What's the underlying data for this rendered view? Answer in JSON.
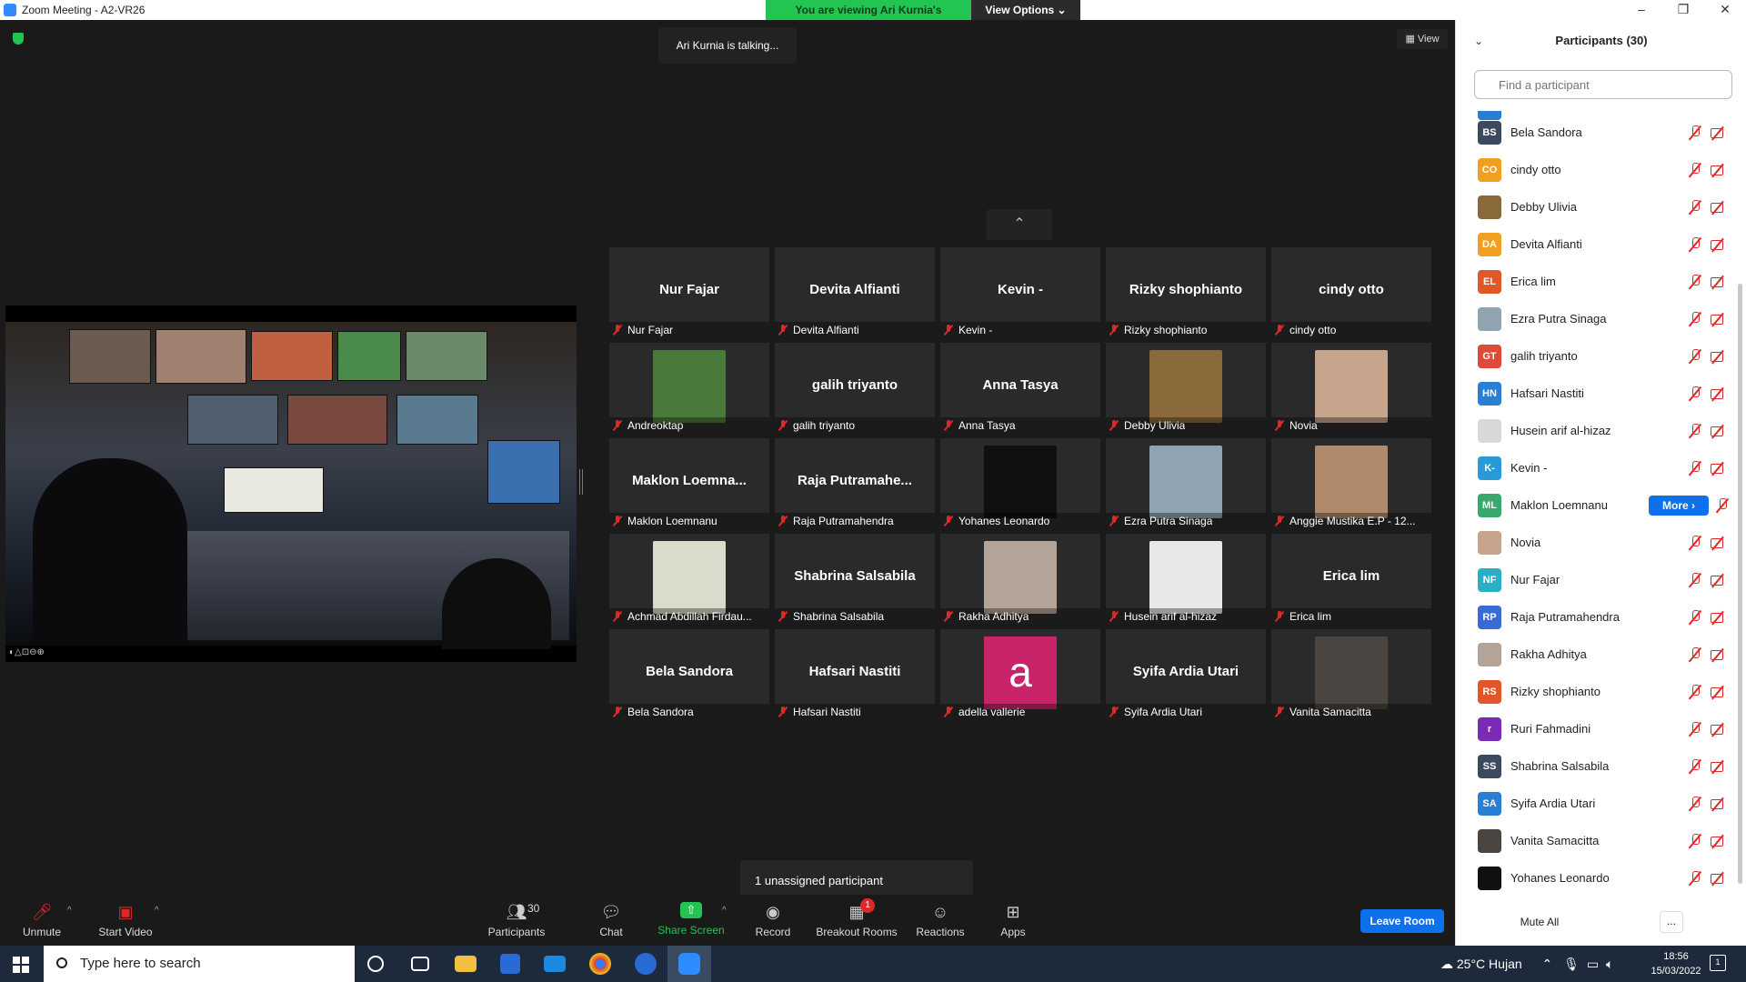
{
  "window": {
    "title": "Zoom Meeting - A2-VR26"
  },
  "banner": {
    "viewing": "You are viewing Ari Kurnia's screen",
    "view_options": "View Options ⌄"
  },
  "talking": "Ari Kurnia is talking...",
  "view_button": "View",
  "grid": [
    {
      "big": "Nur Fajar",
      "name": "Nur Fajar"
    },
    {
      "big": "Devita Alfianti",
      "name": "Devita Alfianti"
    },
    {
      "big": "Kevin -",
      "name": "Kevin -"
    },
    {
      "big": "Rizky shophianto",
      "name": "Rizky shophianto"
    },
    {
      "big": "cindy otto",
      "name": "cindy otto"
    },
    {
      "img": "#4a7a3a",
      "name": "Andreoktap"
    },
    {
      "big": "galih triyanto",
      "name": "galih triyanto"
    },
    {
      "big": "Anna Tasya",
      "name": "Anna Tasya"
    },
    {
      "img": "#8a6a3a",
      "name": "Debby Ulivia"
    },
    {
      "img": "#c7a48c",
      "name": "Novia"
    },
    {
      "big": "Maklon  Loemna...",
      "name": "Maklon Loemnanu"
    },
    {
      "big": "Raja  Putramahe...",
      "name": "Raja Putramahendra"
    },
    {
      "img": "#101010",
      "name": "Yohanes Leonardo"
    },
    {
      "img": "#8fa3b0",
      "name": "Ezra Putra Sinaga"
    },
    {
      "img": "#b08a6a",
      "name": "Anggie Mustika E.P - 12..."
    },
    {
      "img": "#d9dccb",
      "name": "Achmad Abdillah Firdau..."
    },
    {
      "big": "Shabrina Salsabila",
      "name": "Shabrina Salsabila"
    },
    {
      "img": "#b4a498",
      "name": "Rakha Adhitya"
    },
    {
      "img": "#e8e8e8",
      "name": "Husein arif al-hizaz"
    },
    {
      "big": "Erica lim",
      "name": "Erica lim"
    },
    {
      "big": "Bela Sandora",
      "name": "Bela Sandora"
    },
    {
      "big": "Hafsari Nastiti",
      "name": "Hafsari Nastiti"
    },
    {
      "letter": "a",
      "name": "adella vallerie"
    },
    {
      "big": "Syifa Ardia Utari",
      "name": "Syifa Ardia Utari"
    },
    {
      "img": "#4a4540",
      "name": "Vanita Samacitta"
    }
  ],
  "toast": "1 unassigned participant",
  "toolbar": {
    "unmute": "Unmute",
    "start_video": "Start Video",
    "participants": "Participants",
    "participants_count": "30",
    "chat": "Chat",
    "share_screen": "Share Screen",
    "record": "Record",
    "breakout_rooms": "Breakout Rooms",
    "breakout_badge": "1",
    "reactions": "Reactions",
    "apps": "Apps",
    "leave_room": "Leave Room"
  },
  "panel": {
    "title": "Participants (30)",
    "search_placeholder": "Find a participant",
    "more_label": "More ›",
    "mute_all": "Mute All",
    "more_dots": "...",
    "participants": [
      {
        "initials": "BS",
        "name": "Bela Sandora",
        "color": "#3b4a5e"
      },
      {
        "initials": "CO",
        "name": "cindy otto",
        "color": "#f0a020"
      },
      {
        "initials": "",
        "name": "Debby Ulivia",
        "color": "#8a6a3a"
      },
      {
        "initials": "DA",
        "name": "Devita Alfianti",
        "color": "#f0a020"
      },
      {
        "initials": "EL",
        "name": "Erica lim",
        "color": "#e0582a"
      },
      {
        "initials": "",
        "name": "Ezra Putra Sinaga",
        "color": "#8fa3b0"
      },
      {
        "initials": "GT",
        "name": "galih triyanto",
        "color": "#e04a3a"
      },
      {
        "initials": "HN",
        "name": "Hafsari Nastiti",
        "color": "#2a7fd4"
      },
      {
        "initials": "",
        "name": "Husein arif al-hizaz",
        "color": "#d8d8d8"
      },
      {
        "initials": "K-",
        "name": "Kevin -",
        "color": "#2a9ad4"
      },
      {
        "initials": "ML",
        "name": "Maklon Loemnanu",
        "color": "#3aa86a",
        "more": true
      },
      {
        "initials": "",
        "name": "Novia",
        "color": "#c7a48c"
      },
      {
        "initials": "NF",
        "name": "Nur Fajar",
        "color": "#2ab0c4"
      },
      {
        "initials": "RP",
        "name": "Raja Putramahendra",
        "color": "#3a6ad4"
      },
      {
        "initials": "",
        "name": "Rakha Adhitya",
        "color": "#b4a498"
      },
      {
        "initials": "RS",
        "name": "Rizky shophianto",
        "color": "#e0582a"
      },
      {
        "initials": "r",
        "name": "Ruri Fahmadini",
        "color": "#7a2ab4"
      },
      {
        "initials": "SS",
        "name": "Shabrina Salsabila",
        "color": "#3b4a5e"
      },
      {
        "initials": "SA",
        "name": "Syifa Ardia Utari",
        "color": "#2a7fd4"
      },
      {
        "initials": "",
        "name": "Vanita Samacitta",
        "color": "#4a4540"
      },
      {
        "initials": "",
        "name": "Yohanes Leonardo",
        "color": "#101010"
      }
    ]
  },
  "taskbar": {
    "search_placeholder": "Type here to search",
    "weather": "25°C  Hujan",
    "time": "18:56",
    "date": "15/03/2022",
    "notif_count": "1"
  },
  "colors": {
    "accent": "#0e71eb",
    "green": "#23c552",
    "muted_red": "#e02828"
  }
}
